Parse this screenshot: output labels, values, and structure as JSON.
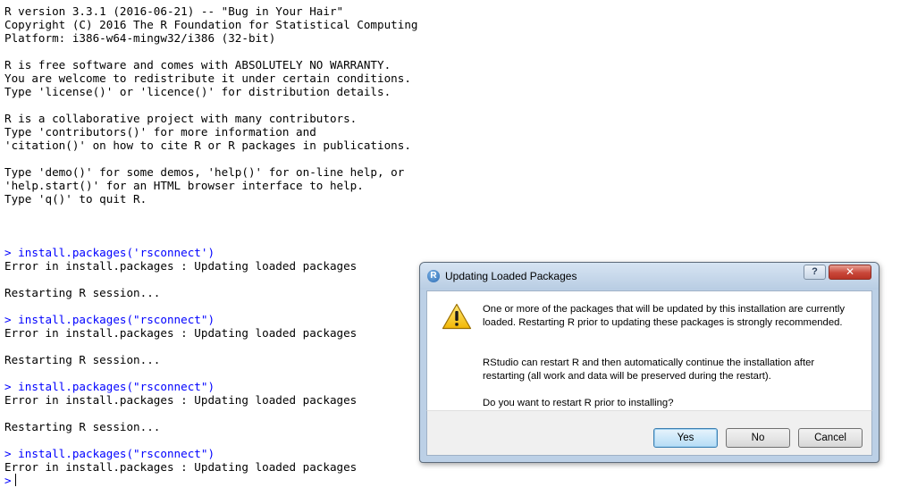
{
  "console": {
    "lines": [
      {
        "text": "R version 3.3.1 (2016-06-21) -- \"Bug in Your Hair\"",
        "kind": "output"
      },
      {
        "text": "Copyright (C) 2016 The R Foundation for Statistical Computing",
        "kind": "output"
      },
      {
        "text": "Platform: i386-w64-mingw32/i386 (32-bit)",
        "kind": "output"
      },
      {
        "text": "",
        "kind": "output"
      },
      {
        "text": "R is free software and comes with ABSOLUTELY NO WARRANTY.",
        "kind": "output"
      },
      {
        "text": "You are welcome to redistribute it under certain conditions.",
        "kind": "output"
      },
      {
        "text": "Type 'license()' or 'licence()' for distribution details.",
        "kind": "output"
      },
      {
        "text": "",
        "kind": "output"
      },
      {
        "text": "R is a collaborative project with many contributors.",
        "kind": "output"
      },
      {
        "text": "Type 'contributors()' for more information and",
        "kind": "output"
      },
      {
        "text": "'citation()' on how to cite R or R packages in publications.",
        "kind": "output"
      },
      {
        "text": "",
        "kind": "output"
      },
      {
        "text": "Type 'demo()' for some demos, 'help()' for on-line help, or",
        "kind": "output"
      },
      {
        "text": "'help.start()' for an HTML browser interface to help.",
        "kind": "output"
      },
      {
        "text": "Type 'q()' to quit R.",
        "kind": "output"
      },
      {
        "text": "",
        "kind": "output"
      },
      {
        "text": "",
        "kind": "output"
      },
      {
        "text": "",
        "kind": "output"
      },
      {
        "text": "> install.packages('rsconnect')",
        "kind": "prompt"
      },
      {
        "text": "Error in install.packages : Updating loaded packages",
        "kind": "output"
      },
      {
        "text": "",
        "kind": "output"
      },
      {
        "text": "Restarting R session...",
        "kind": "output"
      },
      {
        "text": "",
        "kind": "output"
      },
      {
        "text": "> install.packages(\"rsconnect\")",
        "kind": "prompt"
      },
      {
        "text": "Error in install.packages : Updating loaded packages",
        "kind": "output"
      },
      {
        "text": "",
        "kind": "output"
      },
      {
        "text": "Restarting R session...",
        "kind": "output"
      },
      {
        "text": "",
        "kind": "output"
      },
      {
        "text": "> install.packages(\"rsconnect\")",
        "kind": "prompt"
      },
      {
        "text": "Error in install.packages : Updating loaded packages",
        "kind": "output"
      },
      {
        "text": "",
        "kind": "output"
      },
      {
        "text": "Restarting R session...",
        "kind": "output"
      },
      {
        "text": "",
        "kind": "output"
      },
      {
        "text": "> install.packages(\"rsconnect\")",
        "kind": "prompt"
      },
      {
        "text": "Error in install.packages : Updating loaded packages",
        "kind": "output"
      },
      {
        "text": ">",
        "kind": "prompt"
      }
    ],
    "prompt_color": "#0000ff",
    "output_color": "#000000"
  },
  "dialog": {
    "title": "Updating Loaded Packages",
    "app_icon_letter": "R",
    "help_button": "?",
    "close_button": "✕",
    "icon": "warning-icon",
    "message_1": "One or more of the packages that will be updated by this installation are currently loaded. Restarting R prior to updating these packages is strongly recommended.",
    "message_2": "RStudio can restart R and then automatically continue the installation after restarting (all work and data will be preserved during the restart).",
    "message_3": "Do you want to restart R prior to installing?",
    "buttons": {
      "yes": "Yes",
      "no": "No",
      "cancel": "Cancel"
    }
  }
}
